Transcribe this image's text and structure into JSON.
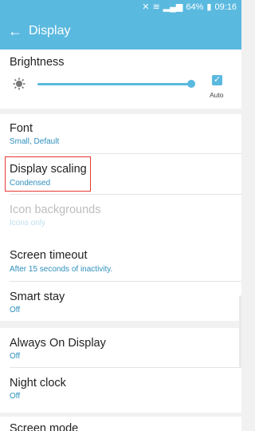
{
  "status_bar": {
    "signal_text": "№",
    "battery": "64%",
    "time": "09:16"
  },
  "app_bar": {
    "title": "Display",
    "back_label": "←"
  },
  "brightness": {
    "label": "Brightness",
    "level": 0.98,
    "auto_label": "Auto",
    "auto_checked": true
  },
  "section2": {
    "font": {
      "label": "Font",
      "sub": "Small, Default"
    },
    "display_scaling": {
      "label": "Display scaling",
      "sub": "Condensed"
    },
    "icon_backgrounds": {
      "label": "Icon backgrounds",
      "sub": "Icons only"
    }
  },
  "section3": {
    "screen_timeout": {
      "label": "Screen timeout",
      "sub": "After 15 seconds of inactivity."
    },
    "smart_stay": {
      "label": "Smart stay",
      "sub": "Off"
    }
  },
  "section4": {
    "always_on_display": {
      "label": "Always On Display",
      "sub": "Off"
    },
    "night_clock": {
      "label": "Night clock",
      "sub": "Off"
    }
  },
  "section5": {
    "screen_mode": {
      "label": "Screen mode"
    }
  },
  "colors": {
    "accent": "#5ab9df",
    "highlight": "#e53935"
  },
  "icons": [
    "mute-icon",
    "wifi-icon",
    "signal-icon",
    "battery-icon",
    "back-arrow-icon",
    "brightness-icon",
    "checkbox-icon"
  ]
}
